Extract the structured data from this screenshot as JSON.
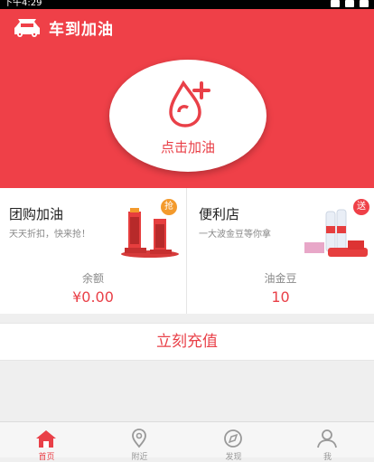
{
  "status_bar": {
    "time": "下午4:29"
  },
  "header": {
    "title": "车到加油",
    "icon": "car-icon"
  },
  "refuel_button": {
    "label": "点击加油",
    "icon": "fuel-drop-plus-icon"
  },
  "cards": [
    {
      "title": "团购加油",
      "subtitle": "天天折扣，快来抢！",
      "badge": "抢",
      "badge_color": "#f39a2c"
    },
    {
      "title": "便利店",
      "subtitle": "一大波金豆等你拿",
      "badge": "送",
      "badge_color": "#ef4048"
    }
  ],
  "balance": [
    {
      "label": "余额",
      "value": "¥0.00"
    },
    {
      "label": "油金豆",
      "value": "10"
    }
  ],
  "recharge": {
    "label": "立刻充值"
  },
  "tabs": [
    {
      "label": "首页",
      "icon": "home-icon",
      "active": true
    },
    {
      "label": "附近",
      "icon": "location-pin-icon",
      "active": false
    },
    {
      "label": "发现",
      "icon": "compass-icon",
      "active": false
    },
    {
      "label": "我",
      "icon": "user-icon",
      "active": false
    }
  ],
  "colors": {
    "brand": "#ef4048",
    "accent_orange": "#f39a2c"
  }
}
